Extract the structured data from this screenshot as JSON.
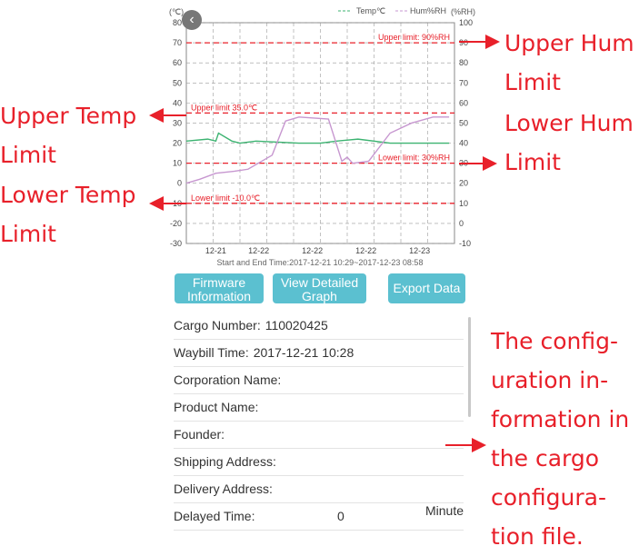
{
  "chart_data": {
    "type": "line",
    "left_unit": "(℃)",
    "right_unit": "(%RH)",
    "y_left_ticks": [
      "80",
      "70",
      "60",
      "50",
      "40",
      "30",
      "20",
      "10",
      "0",
      "-10",
      "-20",
      "-30"
    ],
    "y_right_ticks": [
      "100",
      "90",
      "80",
      "70",
      "60",
      "50",
      "40",
      "30",
      "20",
      "10",
      "0",
      "-10"
    ],
    "ylim_left": [
      -30,
      80
    ],
    "ylim_right": [
      -10,
      100
    ],
    "x_ticks": [
      "12-21",
      "12-22",
      "12-22",
      "12-22",
      "12-23"
    ],
    "x_tick_times": [
      0.55,
      1.35,
      2.35,
      3.35,
      4.35
    ],
    "grid": true,
    "legend_position": "top",
    "series": [
      {
        "name": "Temp℃",
        "axis": "left",
        "color": "#3cb371",
        "x": [
          0,
          0.4,
          0.55,
          0.6,
          0.85,
          1.0,
          1.3,
          2.1,
          2.5,
          2.8,
          3.2,
          3.8,
          4.35,
          4.9
        ],
        "y": [
          21,
          22,
          21,
          25,
          21,
          20,
          21,
          20,
          20,
          21,
          22,
          20,
          20,
          20
        ]
      },
      {
        "name": "Hum%RH",
        "axis": "right",
        "color": "#c797d0",
        "x": [
          0,
          0.25,
          0.55,
          0.9,
          1.15,
          1.6,
          1.85,
          2.1,
          2.65,
          2.9,
          3.0,
          3.1,
          3.4,
          3.8,
          4.2,
          4.6,
          4.9
        ],
        "y": [
          20,
          22,
          25,
          26,
          27,
          34,
          51,
          53,
          52,
          31,
          33,
          30,
          31,
          45,
          50,
          53,
          53
        ]
      }
    ],
    "limits": [
      {
        "label": "Upper limit: 90%RH",
        "axis": "right",
        "value": 90,
        "align": "right"
      },
      {
        "label": "Upper limit 35.0℃",
        "axis": "left",
        "value": 35,
        "align": "left"
      },
      {
        "label": "Lower limit: 30%RH",
        "axis": "right",
        "value": 30,
        "align": "right"
      },
      {
        "label": "Lower limit -10.0℃",
        "axis": "left",
        "value": -10,
        "align": "left"
      }
    ],
    "subtitle": "Start and End Time:2017-12-21 10:29~2017-12-23 08:58"
  },
  "colors": {
    "limit": "#e8202a",
    "grid": "#9a9a9a",
    "button": "#5bc0d0",
    "annotation": "#e8202a"
  },
  "buttons": {
    "firmware": [
      "Firmware",
      "Information"
    ],
    "detail": [
      "View Detailed",
      "Graph"
    ],
    "export": "Export Data"
  },
  "info": [
    {
      "label": "Cargo Number:",
      "value": "110020425"
    },
    {
      "label": "Waybill Time:",
      "value": "2017-12-21  10:28"
    },
    {
      "label": "Corporation Name:",
      "value": ""
    },
    {
      "label": "Product Name:",
      "value": ""
    },
    {
      "label": "Founder:",
      "value": ""
    },
    {
      "label": "Shipping Address:",
      "value": ""
    },
    {
      "label": "Delivery Address:",
      "value": ""
    },
    {
      "label": "Delayed Time:",
      "value": "0",
      "unit": "Minute"
    }
  ],
  "annotations": {
    "upper_hum": [
      "Upper Hum",
      "Limit"
    ],
    "lower_hum": [
      "Lower Hum",
      "Limit"
    ],
    "upper_temp": [
      "Upper Temp",
      "Limit"
    ],
    "lower_temp": [
      "Lower Temp",
      "Limit"
    ],
    "config": [
      "The config-",
      "uration in-",
      "formation in",
      "the cargo",
      "configura-",
      "tion file."
    ]
  },
  "icons": {
    "back": "back-arrow-icon"
  }
}
